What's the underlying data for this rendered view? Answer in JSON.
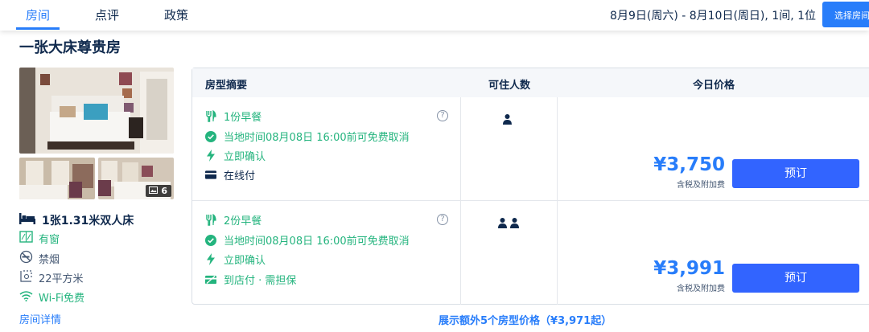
{
  "tabs": [
    {
      "label": "房间",
      "active": true
    },
    {
      "label": "点评",
      "active": false
    },
    {
      "label": "政策",
      "active": false
    }
  ],
  "header": {
    "stay_info": "8月9日(周六) - 8月10日(周日), 1间, 1位",
    "select_room_label": "选择房间"
  },
  "room": {
    "title": "一张大床尊贵房",
    "photo_count": "6",
    "bed": "1张1.31米双人床",
    "features": [
      {
        "icon": "window-icon",
        "label": "有窗"
      },
      {
        "icon": "no-smoking-icon",
        "label": "禁烟"
      },
      {
        "icon": "area-icon",
        "label": "22平方米"
      },
      {
        "icon": "wifi-icon",
        "label": "Wi-Fi免费"
      }
    ],
    "detail_link": "房间详情"
  },
  "table": {
    "headers": {
      "summary": "房型摘要",
      "occupancy": "可住人数",
      "price": "今日价格"
    },
    "rows": [
      {
        "perks": [
          {
            "icon": "meal-icon",
            "label": "1份早餐"
          },
          {
            "icon": "check-circle-icon",
            "label": "当地时间08月08日 16:00前可免费取消"
          },
          {
            "icon": "lightning-icon",
            "label": "立即确认"
          },
          {
            "icon": "card-icon",
            "label": "在线付"
          }
        ],
        "guests": 1,
        "price": "¥3,750",
        "tax_note": "含税及附加费",
        "book_label": "预订"
      },
      {
        "perks": [
          {
            "icon": "meal-icon",
            "label": "2份早餐"
          },
          {
            "icon": "check-circle-icon",
            "label": "当地时间08月08日 16:00前可免费取消"
          },
          {
            "icon": "lightning-icon",
            "label": "立即确认"
          },
          {
            "icon": "pay-at-hotel-icon",
            "label": "到店付 · 需担保"
          }
        ],
        "guests": 2,
        "price": "¥3,991",
        "tax_note": "含税及附加费",
        "book_label": "预订"
      }
    ]
  },
  "more_rates_link": "展示额外5个房型价格（¥3,971起）",
  "colors": {
    "accent": "#287dfa",
    "button": "#3264ff",
    "green": "#24b47e"
  }
}
